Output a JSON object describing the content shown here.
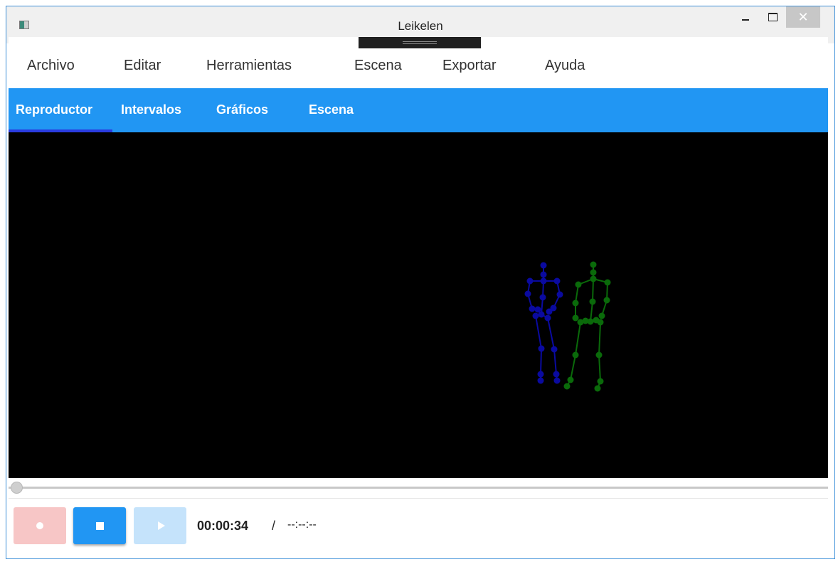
{
  "window": {
    "title": "Leikelen",
    "close_glyph": "✕"
  },
  "menu": {
    "items": [
      {
        "label": "Archivo"
      },
      {
        "label": "Editar"
      },
      {
        "label": "Herramientas"
      },
      {
        "label": "Escena"
      },
      {
        "label": "Exportar"
      },
      {
        "label": "Ayuda"
      }
    ]
  },
  "tabs": {
    "items": [
      {
        "label": "Reproductor",
        "active": true
      },
      {
        "label": "Intervalos"
      },
      {
        "label": "Gráficos"
      },
      {
        "label": "Escena"
      }
    ],
    "background": "#2196f3"
  },
  "viewport": {
    "background": "#000000",
    "skeletons": [
      {
        "name": "skeleton-blue",
        "color": "#0a0aa0"
      },
      {
        "name": "skeleton-green",
        "color": "#0a6a0a"
      }
    ]
  },
  "player": {
    "progress": 0,
    "current_time": "00:00:34",
    "separator": "/",
    "total_time": "--:--:--",
    "record_icon": "record-icon",
    "stop_icon": "stop-icon",
    "play_icon": "play-icon"
  }
}
